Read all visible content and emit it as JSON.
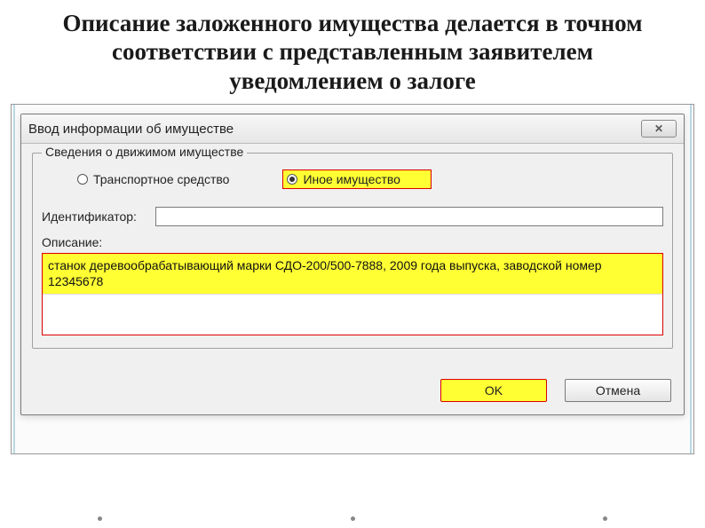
{
  "slide": {
    "title": "Описание заложенного имущества делается в точном соответствии с представленным заявителем уведомлением о залоге"
  },
  "dialog": {
    "title": "Ввод информации об имуществе",
    "close_symbol": "✕"
  },
  "group": {
    "legend": "Сведения о движимом имуществе",
    "radio_transport": "Транспортное средство",
    "radio_other": "Иное имущество",
    "selected": "other",
    "identifier_label": "Идентификатор:",
    "identifier_value": "",
    "description_label": "Описание:",
    "description_value": "станок деревообрабатывающий марки СДО-200/500-7888, 2009 года выпуска, заводской номер 12345678"
  },
  "buttons": {
    "ok": "OK",
    "cancel": "Отмена"
  }
}
